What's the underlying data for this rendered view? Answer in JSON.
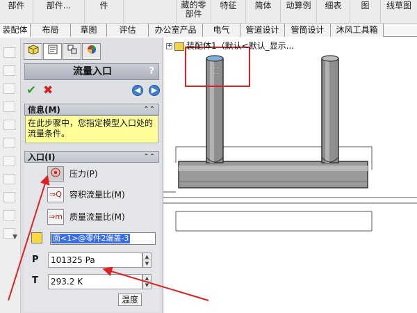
{
  "ribbon": {
    "items": [
      "部件",
      "部件...",
      "件",
      "藏的零\n部件",
      "特征",
      "简体",
      "动算例",
      "细表",
      "图",
      "线草图"
    ]
  },
  "tabs": {
    "items": [
      "装配体",
      "布局",
      "草图",
      "评估",
      "办公室产品",
      "电气",
      "管道设计",
      "管筒设计",
      "沐风工具箱"
    ],
    "active_index": 0
  },
  "property_manager": {
    "title": "流量入口",
    "help": "?",
    "pm_tabs": [
      "feature-manager-tab",
      "property-manager-tab",
      "configuration-manager-tab",
      "appearance-tab"
    ],
    "info": {
      "header": "信息(M)",
      "text": "在此步骤中，您指定模型入口处的流量条件。"
    },
    "inlet": {
      "header": "入口(I)",
      "options": [
        {
          "label": "压力(P)",
          "icon": "pressure-icon",
          "selected": true
        },
        {
          "label": "容积流量比(M)",
          "icon": "volume-flow-icon",
          "badge": "Q",
          "selected": false
        },
        {
          "label": "质量流量比(M)",
          "icon": "mass-flow-icon",
          "badge": "m",
          "selected": false
        }
      ],
      "face_selection": "面<1>@零件2端盖-3",
      "pressure_label": "P",
      "pressure_value": "101325 Pa",
      "temperature_label": "T",
      "temperature_value": "293.2 K",
      "tooltip": "温度"
    }
  },
  "graphics": {
    "tree_label": "装配体1（默认<默认_显示...",
    "annotation_color": "#e02020",
    "model_color": "#8e8e8e"
  }
}
